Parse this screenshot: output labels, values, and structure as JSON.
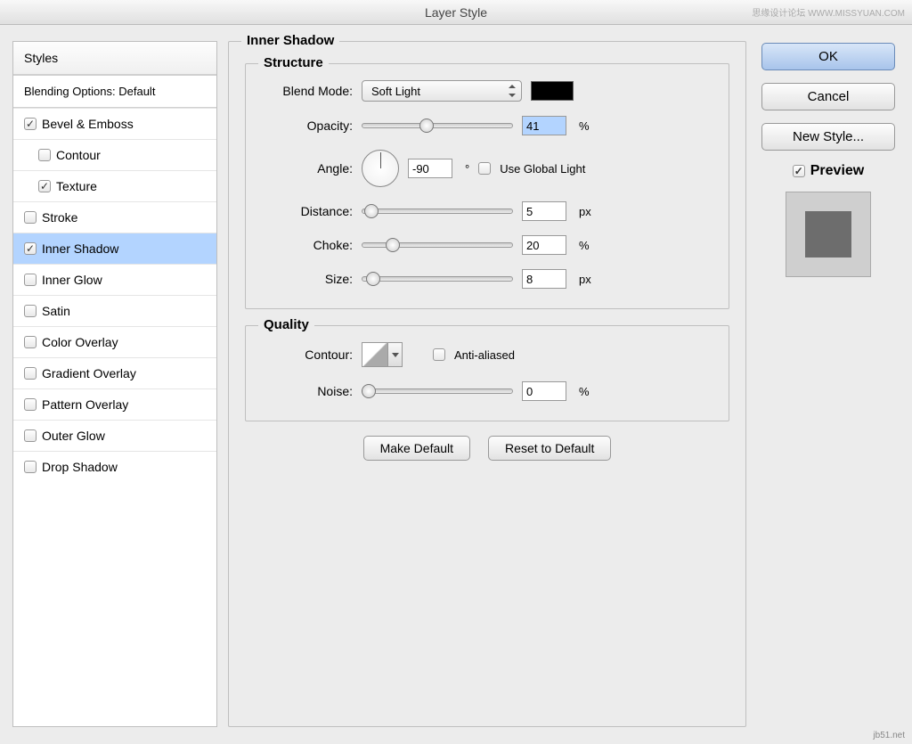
{
  "window": {
    "title": "Layer Style"
  },
  "sidebar": {
    "header": "Styles",
    "blending": "Blending Options: Default",
    "items": [
      {
        "label": "Bevel & Emboss",
        "checked": true,
        "indent": false
      },
      {
        "label": "Contour",
        "checked": false,
        "indent": true
      },
      {
        "label": "Texture",
        "checked": true,
        "indent": true
      },
      {
        "label": "Stroke",
        "checked": false,
        "indent": false
      },
      {
        "label": "Inner Shadow",
        "checked": true,
        "indent": false,
        "selected": true
      },
      {
        "label": "Inner Glow",
        "checked": false,
        "indent": false
      },
      {
        "label": "Satin",
        "checked": false,
        "indent": false
      },
      {
        "label": "Color Overlay",
        "checked": false,
        "indent": false
      },
      {
        "label": "Gradient Overlay",
        "checked": false,
        "indent": false
      },
      {
        "label": "Pattern Overlay",
        "checked": false,
        "indent": false
      },
      {
        "label": "Outer Glow",
        "checked": false,
        "indent": false
      },
      {
        "label": "Drop Shadow",
        "checked": false,
        "indent": false
      }
    ]
  },
  "panel": {
    "title": "Inner Shadow",
    "structure": {
      "title": "Structure",
      "blendModeLabel": "Blend Mode:",
      "blendModeValue": "Soft Light",
      "opacityLabel": "Opacity:",
      "opacityValue": "41",
      "opacityUnit": "%",
      "angleLabel": "Angle:",
      "angleValue": "-90",
      "angleUnit": "°",
      "useGlobalLabel": "Use Global Light",
      "useGlobalChecked": false,
      "distanceLabel": "Distance:",
      "distanceValue": "5",
      "distanceUnit": "px",
      "chokeLabel": "Choke:",
      "chokeValue": "20",
      "chokeUnit": "%",
      "sizeLabel": "Size:",
      "sizeValue": "8",
      "sizeUnit": "px"
    },
    "quality": {
      "title": "Quality",
      "contourLabel": "Contour:",
      "antiAliasedLabel": "Anti-aliased",
      "antiAliasedChecked": false,
      "noiseLabel": "Noise:",
      "noiseValue": "0",
      "noiseUnit": "%"
    },
    "makeDefault": "Make Default",
    "resetDefault": "Reset to Default"
  },
  "buttons": {
    "ok": "OK",
    "cancel": "Cancel",
    "newStyle": "New Style...",
    "previewLabel": "Preview"
  },
  "watermark": {
    "top": "思缘设计论坛  WWW.MISSYUAN.COM",
    "bottom": "jb51.net"
  }
}
